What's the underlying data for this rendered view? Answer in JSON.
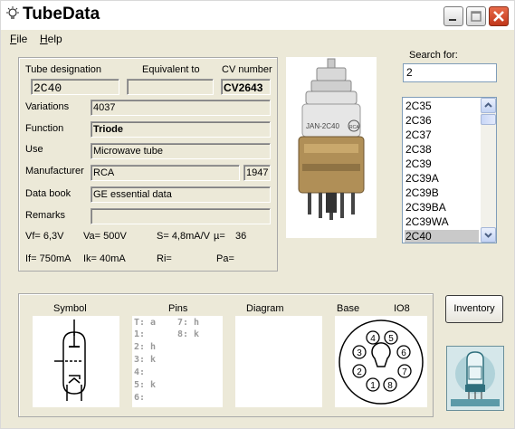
{
  "window": {
    "title": "TubeData"
  },
  "menu": [
    {
      "label": "File"
    },
    {
      "label": "Help"
    }
  ],
  "header": {
    "designation_label": "Tube designation",
    "equivalent_label": "Equivalent to",
    "cv_label": "CV number",
    "designation": "2C40",
    "equivalent": "",
    "cv": "CV2643"
  },
  "details": {
    "variations_label": "Variations",
    "variations": "4037",
    "function_label": "Function",
    "function": "Triode",
    "use_label": "Use",
    "use": "Microwave tube",
    "manufacturer_label": "Manufacturer",
    "manufacturer": "RCA",
    "year": "1947",
    "databook_label": "Data book",
    "databook": "GE essential data",
    "remarks_label": "Remarks",
    "remarks": ""
  },
  "params": {
    "vf": "Vf= 6,3V",
    "va": "Va= 500V",
    "s": "S= 4,8mA/V",
    "mu": "µ=",
    "mu_val": "36",
    "if": "If= 750mA",
    "ik": "Ik= 40mA",
    "ri": "Ri=",
    "pa": "Pa="
  },
  "photo": {
    "tube_print": "JAN-2C40",
    "brand": "RCA"
  },
  "search": {
    "label": "Search for:",
    "value": "2"
  },
  "list": {
    "items": [
      "2C35",
      "2C36",
      "2C37",
      "2C38",
      "2C39",
      "2C39A",
      "2C39B",
      "2C39BA",
      "2C39WA",
      "2C40"
    ],
    "selected": "2C40"
  },
  "bottom": {
    "symbol_label": "Symbol",
    "pins_label": "Pins",
    "diagram_label": "Diagram",
    "base_label": "Base",
    "base_type": "IO8",
    "pins_col1": [
      "T: a",
      "1:",
      "2: h",
      "3: k",
      "4:",
      "5: k",
      "6:"
    ],
    "pins_col2": [
      "7: h",
      "8: k"
    ],
    "socket_pins": [
      "1",
      "2",
      "3",
      "4",
      "5",
      "6",
      "7",
      "8"
    ]
  },
  "inventory_label": "Inventory",
  "colors": {
    "selection": "#c9c9c9",
    "close_red": "#c1361a",
    "pins_grey": "#9a9a9a"
  }
}
